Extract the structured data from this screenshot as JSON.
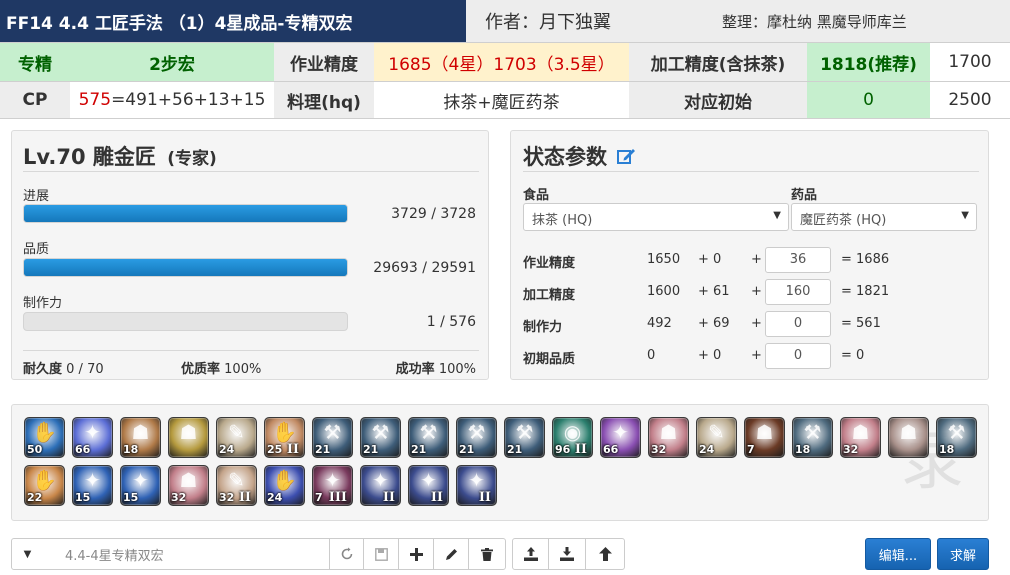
{
  "header": {
    "title": "FF14 4.4 工匠手法 （1）4星成品-专精双宏",
    "author": "作者：月下独翼",
    "organizer": "整理：摩杜纳 黑魔导师库兰",
    "row2": {
      "specialist_label": "专精",
      "macro_steps": "2步宏",
      "craftsmanship_label": "作业精度",
      "craftsmanship_value": "1685（4星）1703（3.5星）",
      "control_label": "加工精度(含抹茶)",
      "control_recommended": "1818(推荐)",
      "control_alt": "1700"
    },
    "row3": {
      "cp_label": "CP",
      "cp_total": "575",
      "cp_breakdown": "=491+56+13+15",
      "food_label": "料理(hq)",
      "food_value": "抹茶+魔匠药茶",
      "initial_label": "对应初始",
      "initial_value": "0",
      "initial_alt": "2500"
    }
  },
  "status_panel": {
    "title": "Lv.70 雕金匠",
    "subtitle": "(专家)",
    "progress": {
      "label": "进展",
      "text": "3729 / 3728",
      "fill": 1.0
    },
    "quality": {
      "label": "品质",
      "text": "29693 / 29591",
      "fill": 1.0
    },
    "cp": {
      "label": "制作力",
      "text": "1 / 576",
      "fill": 0.0
    },
    "durability_label": "耐久度",
    "durability_value": "0 / 70",
    "hq_label": "优质率",
    "hq_value": "100%",
    "success_label": "成功率",
    "success_value": "100%"
  },
  "params_panel": {
    "title": "状态参数",
    "edit_icon": "edit-icon",
    "food_label": "食品",
    "food_value": "抹茶 (HQ)",
    "medicine_label": "药品",
    "medicine_value": "魔匠药茶 (HQ)",
    "rows": [
      {
        "label": "作业精度",
        "base": "1650",
        "bonus": "+ 0",
        "plus": "+",
        "input": "36",
        "result": "= 1686"
      },
      {
        "label": "加工精度",
        "base": "1600",
        "bonus": "+ 61",
        "plus": "+",
        "input": "160",
        "result": "= 1821"
      },
      {
        "label": "制作力",
        "base": "492",
        "bonus": "+ 69",
        "plus": "+",
        "input": "0",
        "result": "= 561"
      },
      {
        "label": "初期品质",
        "base": "0",
        "bonus": "+ 0",
        "plus": "+",
        "input": "0",
        "result": "= 0"
      }
    ]
  },
  "actions": [
    {
      "name": "action-1",
      "level": "50",
      "tier": "",
      "color": "#2d6fb8",
      "glyph": "✋"
    },
    {
      "name": "action-2",
      "level": "66",
      "tier": "",
      "color": "#5c6ed6",
      "glyph": "✦"
    },
    {
      "name": "action-3",
      "level": "18",
      "tier": "",
      "color": "#b07a48",
      "glyph": "☗"
    },
    {
      "name": "action-4",
      "level": "",
      "tier": "",
      "color": "#b59a3e",
      "glyph": "☗"
    },
    {
      "name": "action-5",
      "level": "24",
      "tier": "",
      "color": "#b9a98c",
      "glyph": "✎"
    },
    {
      "name": "action-6",
      "level": "25",
      "tier": "II",
      "color": "#c18a63",
      "glyph": "✋"
    },
    {
      "name": "action-7",
      "level": "21",
      "tier": "",
      "color": "#3e5d79",
      "glyph": "⚒"
    },
    {
      "name": "action-8",
      "level": "21",
      "tier": "",
      "color": "#3e5d79",
      "glyph": "⚒"
    },
    {
      "name": "action-9",
      "level": "21",
      "tier": "",
      "color": "#3e5d79",
      "glyph": "⚒"
    },
    {
      "name": "action-10",
      "level": "21",
      "tier": "",
      "color": "#3e5d79",
      "glyph": "⚒"
    },
    {
      "name": "action-11",
      "level": "21",
      "tier": "",
      "color": "#3e5d79",
      "glyph": "⚒"
    },
    {
      "name": "action-12",
      "level": "96",
      "tier": "II",
      "color": "#2b7f6e",
      "glyph": "◉"
    },
    {
      "name": "action-13",
      "level": "66",
      "tier": "",
      "color": "#8a4fb2",
      "glyph": "✦"
    },
    {
      "name": "action-14",
      "level": "32",
      "tier": "",
      "color": "#c27f8a",
      "glyph": "☗"
    },
    {
      "name": "action-15",
      "level": "24",
      "tier": "",
      "color": "#b9a98c",
      "glyph": "✎"
    },
    {
      "name": "action-16",
      "level": "7",
      "tier": "",
      "color": "#6b3b26",
      "glyph": "☗"
    },
    {
      "name": "action-17",
      "level": "18",
      "tier": "",
      "color": "#4f6b7f",
      "glyph": "⚒"
    },
    {
      "name": "action-18",
      "level": "32",
      "tier": "",
      "color": "#c27f8a",
      "glyph": "☗"
    },
    {
      "name": "action-19",
      "level": "",
      "tier": "",
      "color": "#a8908a",
      "glyph": "☗"
    },
    {
      "name": "action-20",
      "level": "18",
      "tier": "",
      "color": "#4f6b7f",
      "glyph": "⚒"
    },
    {
      "name": "action-21",
      "level": "22",
      "tier": "",
      "color": "#c9874a",
      "glyph": "✋"
    },
    {
      "name": "action-22",
      "level": "15",
      "tier": "",
      "color": "#2f62b5",
      "glyph": "✦"
    },
    {
      "name": "action-23",
      "level": "15",
      "tier": "",
      "color": "#2f62b5",
      "glyph": "✦"
    },
    {
      "name": "action-24",
      "level": "32",
      "tier": "",
      "color": "#c27f8a",
      "glyph": "☗"
    },
    {
      "name": "action-25",
      "level": "32",
      "tier": "II",
      "color": "#c4a48a",
      "glyph": "✎"
    },
    {
      "name": "action-26",
      "level": "24",
      "tier": "",
      "color": "#3d4fb0",
      "glyph": "✋"
    },
    {
      "name": "action-27",
      "level": "7",
      "tier": "III",
      "color": "#7a3b5e",
      "glyph": "✦"
    },
    {
      "name": "action-28",
      "level": "",
      "tier": "II",
      "color": "#3c4c8e",
      "glyph": "✦"
    },
    {
      "name": "action-29",
      "level": "",
      "tier": "II",
      "color": "#3c4c8e",
      "glyph": "✦"
    },
    {
      "name": "action-30",
      "level": "",
      "tier": "II",
      "color": "#3c4c8e",
      "glyph": "✦"
    }
  ],
  "toolbar": {
    "macro_name_placeholder": "4.4-4星专精双宏",
    "undo_icon": "undo-icon",
    "save_icon": "save-icon",
    "add_icon": "plus-icon",
    "edit_icon": "pencil-icon",
    "delete_icon": "trash-icon",
    "export_icon": "upload-icon",
    "import_icon": "download-icon",
    "up_icon": "arrow-up-icon",
    "edit_button": "编辑...",
    "solve_button": "求解"
  },
  "colors": {
    "title_bg": "#1f3864",
    "green_cell": "#c6efce",
    "cream_cell": "#fff2cc",
    "progress_fill": "#1e8ad0",
    "primary_button": "#1b6ec2"
  }
}
